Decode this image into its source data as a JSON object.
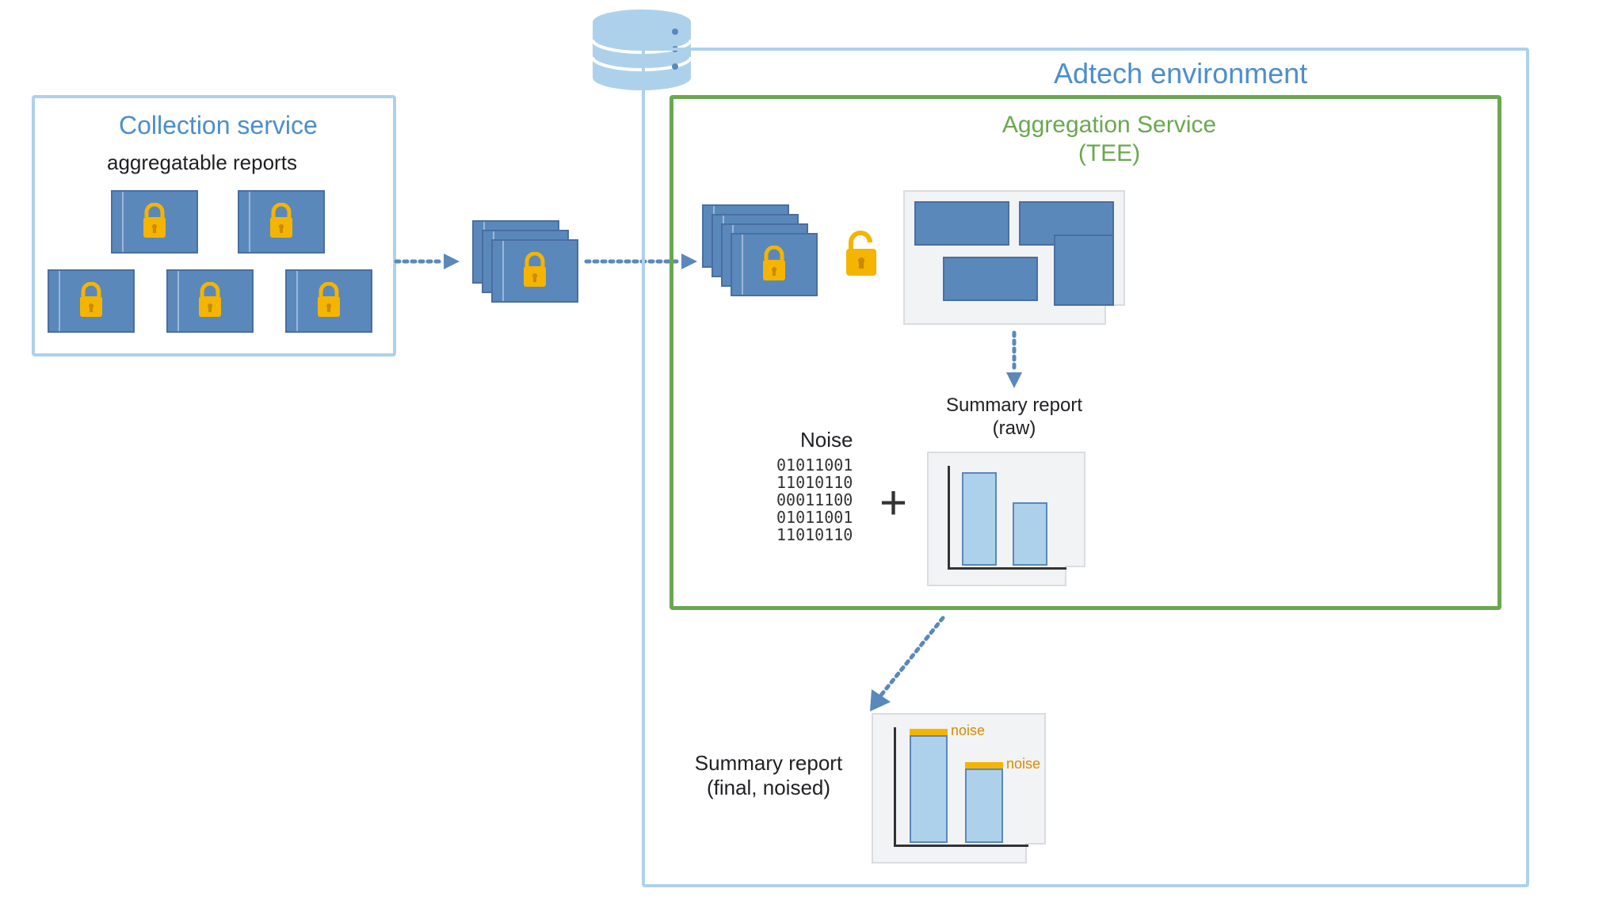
{
  "collection": {
    "title": "Collection service",
    "subtitle": "aggregatable reports"
  },
  "adtech": {
    "title": "Adtech environment"
  },
  "aggregation": {
    "title": "Aggregation Service\n(TEE)"
  },
  "noise": {
    "label": "Noise",
    "bits": "01011001\n11010110\n00011100\n01011001\n11010110"
  },
  "summary_raw": {
    "label": "Summary report\n(raw)"
  },
  "summary_final": {
    "label": "Summary report\n(final, noised)",
    "noise_tag": "noise"
  },
  "icons": {
    "database": "database-icon",
    "lock_closed": "lock-closed-icon",
    "lock_open": "lock-open-icon",
    "plus": "+"
  },
  "colors": {
    "box_border_light": "#aed1eb",
    "box_border_green": "#6aa84f",
    "title_blue": "#4c8ecb",
    "title_green": "#6aa84f",
    "doc_fill": "#5a88bb",
    "lock_gold": "#f4b400"
  }
}
